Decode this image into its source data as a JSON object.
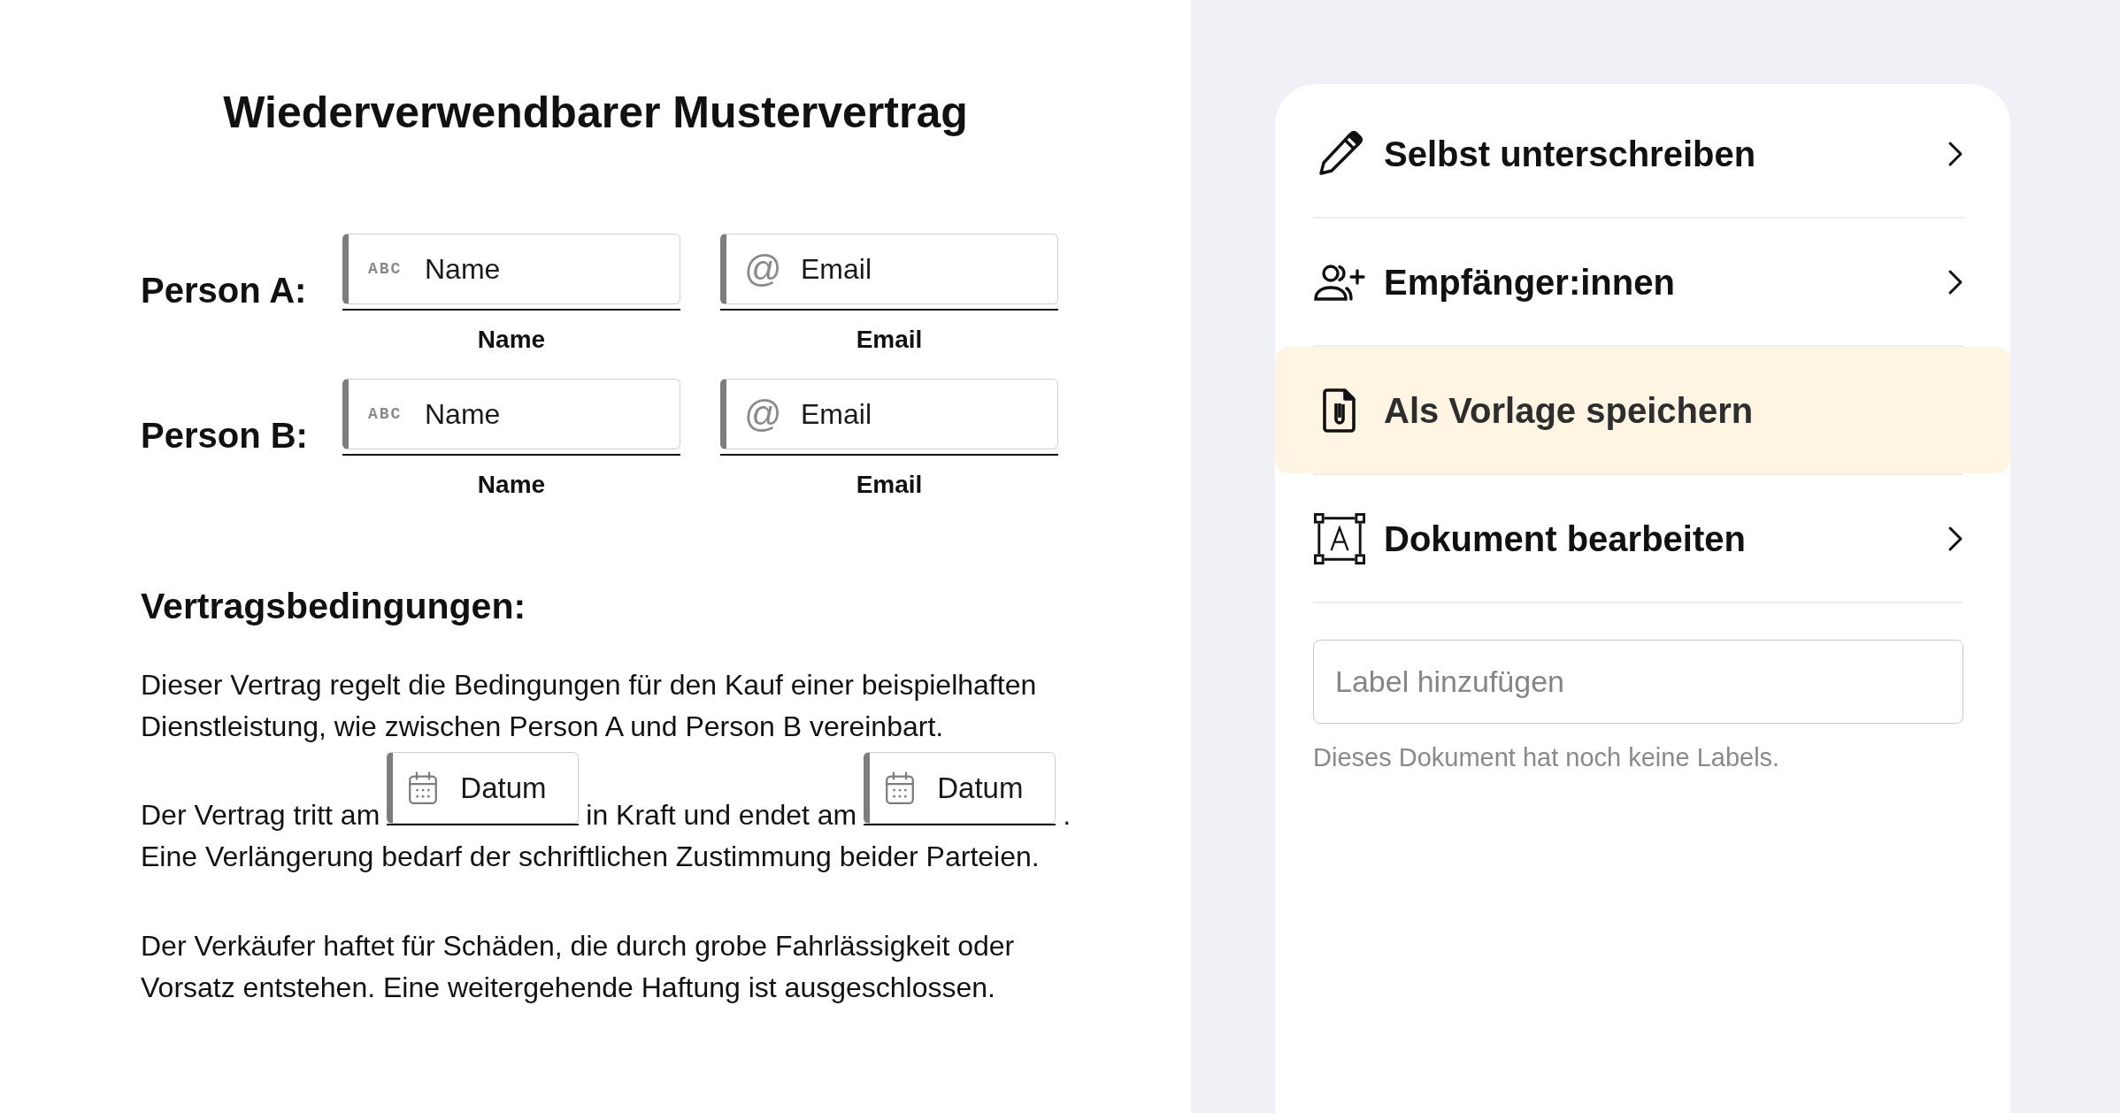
{
  "document": {
    "title": "Wiederverwendbarer Mustervertrag",
    "parties": [
      {
        "label": "Person A:",
        "fields": [
          {
            "icon_text": "ABC",
            "placeholder": "Name",
            "caption": "Name"
          },
          {
            "icon_text": "@",
            "placeholder": "Email",
            "caption": "Email"
          }
        ]
      },
      {
        "label": "Person B:",
        "fields": [
          {
            "icon_text": "ABC",
            "placeholder": "Name",
            "caption": "Name"
          },
          {
            "icon_text": "@",
            "placeholder": "Email",
            "caption": "Email"
          }
        ]
      }
    ],
    "section_heading": "Vertragsbedingungen:",
    "paragraphs": [
      {
        "kind": "text",
        "text": "Dieser Vertrag regelt die Bedingungen für den Kauf einer beispielhaften Dienstleistung, wie zwischen Person A und Person B vereinbart."
      },
      {
        "kind": "fields",
        "lines": [
          [
            {
              "kind": "text",
              "text": "Der Vertrag tritt am"
            },
            {
              "kind": "date",
              "placeholder": "Datum"
            },
            {
              "kind": "text",
              "text": "in Kraft und endet am"
            },
            {
              "kind": "date",
              "placeholder": "Datum"
            },
            {
              "kind": "text",
              "text": "."
            }
          ],
          [
            {
              "kind": "text",
              "text": "Eine Verlängerung bedarf der schriftlichen Zustimmung beider Parteien."
            }
          ]
        ]
      },
      {
        "kind": "text",
        "text": "Der Verkäufer haftet für Schäden, die durch grobe Fahrlässigkeit oder Vorsatz entstehen. Eine weitergehende Haftung ist ausgeschlossen."
      }
    ]
  },
  "panel": {
    "items": [
      {
        "label": "Selbst unterschreiben",
        "selected": false
      },
      {
        "label": "Empfänger:innen",
        "selected": false
      },
      {
        "label": "Als Vorlage speichern",
        "selected": true
      },
      {
        "label": "Dokument bearbeiten",
        "selected": false
      }
    ],
    "label_input": {
      "placeholder": "Label hinzufügen"
    },
    "hint": "Dieses Dokument hat noch keine Labels."
  }
}
